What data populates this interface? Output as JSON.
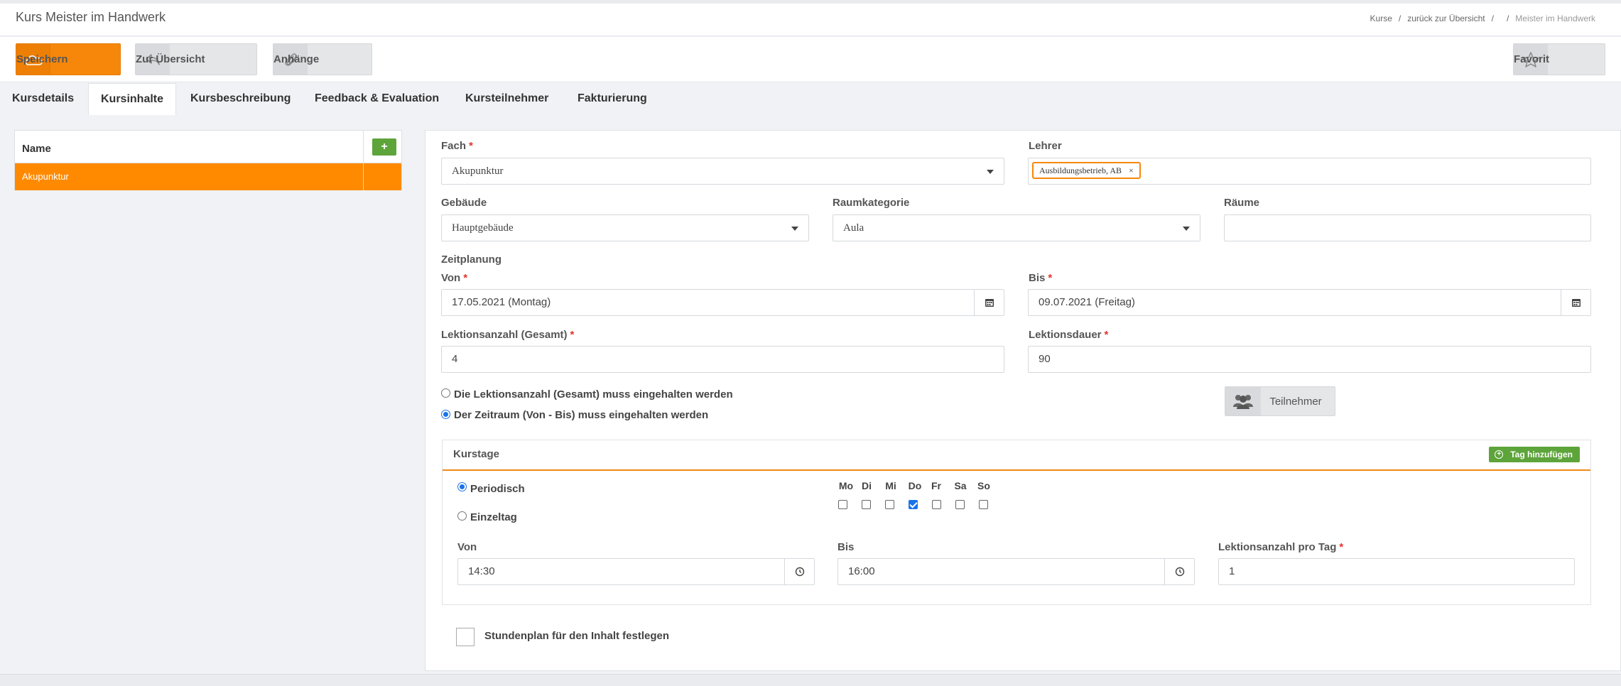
{
  "header": {
    "title": "Kurs Meister im Handwerk",
    "breadcrumb": [
      "Kurse",
      "zurück zur Übersicht",
      "",
      "Meister im Handwerk"
    ]
  },
  "toolbar": {
    "save_label": "Speichern",
    "back_label": "Zur Übersicht",
    "attachments_label": "Anhänge",
    "favorite_label": "Favorit"
  },
  "tabs": [
    {
      "label": "Kursdetails",
      "active": false
    },
    {
      "label": "Kursinhalte",
      "active": true
    },
    {
      "label": "Kursbeschreibung",
      "active": false
    },
    {
      "label": "Feedback & Evaluation",
      "active": false
    },
    {
      "label": "Kursteilnehmer",
      "active": false
    },
    {
      "label": "Fakturierung",
      "active": false
    }
  ],
  "content_list": {
    "header": "Name",
    "add_label": "+",
    "items": [
      "Akupunktur"
    ]
  },
  "form": {
    "fach": {
      "label": "Fach",
      "value": "Akupunktur"
    },
    "lehrer": {
      "label": "Lehrer",
      "tag": "Ausbildungsbetrieb, AB",
      "remove": "×"
    },
    "gebaeude": {
      "label": "Gebäude",
      "value": "Hauptgebäude"
    },
    "raumkategorie": {
      "label": "Raumkategorie",
      "value": "Aula"
    },
    "raeume": {
      "label": "Räume",
      "value": ""
    },
    "zeitplanung": "Zeitplanung",
    "von": {
      "label": "Von",
      "value": "17.05.2021 (Montag)"
    },
    "bis": {
      "label": "Bis",
      "value": "09.07.2021 (Freitag)"
    },
    "lektionsanzahl": {
      "label": "Lektionsanzahl (Gesamt)",
      "value": "4"
    },
    "lektionsdauer": {
      "label": "Lektionsdauer",
      "value": "90"
    },
    "radio_gesamt": "Die Lektionsanzahl (Gesamt) muss eingehalten werden",
    "radio_zeitraum": "Der Zeitraum (Von - Bis) muss eingehalten werden",
    "teilnehmer_label": "Teilnehmer",
    "required_mark": "*"
  },
  "kurstage": {
    "title": "Kurstage",
    "add_label": "Tag hinzufügen",
    "periodisch": "Periodisch",
    "einzeltag": "Einzeltag",
    "days": [
      {
        "label": "Mo",
        "checked": false
      },
      {
        "label": "Di",
        "checked": false
      },
      {
        "label": "Mi",
        "checked": false
      },
      {
        "label": "Do",
        "checked": true
      },
      {
        "label": "Fr",
        "checked": false
      },
      {
        "label": "Sa",
        "checked": false
      },
      {
        "label": "So",
        "checked": false
      }
    ],
    "von": {
      "label": "Von",
      "value": "14:30"
    },
    "bis": {
      "label": "Bis",
      "value": "16:00"
    },
    "pro_tag": {
      "label": "Lektionsanzahl pro Tag",
      "value": "1"
    }
  },
  "stundenplan_label": "Stundenplan für den Inhalt festlegen",
  "colors": {
    "accent": "#f7870a",
    "green": "#5da43a",
    "selected_row": "#ff8a00"
  }
}
